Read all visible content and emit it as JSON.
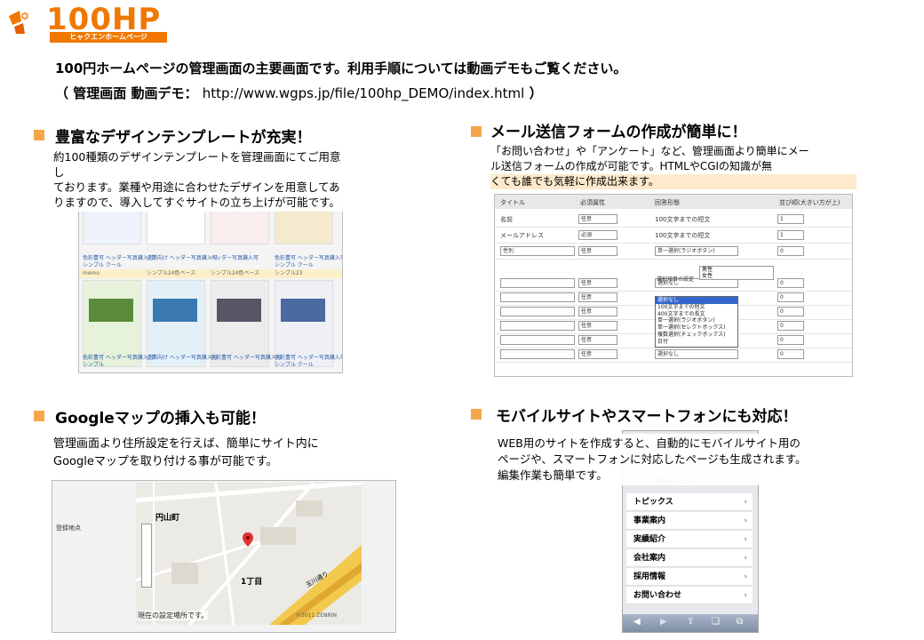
{
  "logo": {
    "text": "100HP",
    "sub": "ヒャクエンホームページ",
    "brand_color": "#f07800"
  },
  "intro": {
    "line1": "100円ホームページの管理画面の主要画面です。利用手順については動画デモもご覧ください。",
    "line2_label": "（ 管理画面  動画デモ：",
    "line2_url": "http://www.wgps.jp/file/100hp_DEMO/index.html",
    "line2_end": "）"
  },
  "sections": {
    "templates": {
      "title": "豊富なデザインテンプレートが充実！",
      "desc": "約100種類のデザインテンプレートを管理画面にてご用意しておりますす。業種や用途に合わせたデザインを用意してありますので、導入してすぐサイトの立ち上げが可能です。",
      "desc_lines": [
        "約100種類のデザインテンプレートを管理画面にてご用意し",
        "ております。業種や用途に合わせたデザインを用意してあ",
        "りますので、導入してすぐサイトの立ち上げが可能です。"
      ],
      "captions": [
        "色彩豊可 ヘッダー写真鎌入可",
        "企業向け ヘッダー写真鎌入可",
        "ヘッダー写真鎌入可",
        "色彩豊可 ヘッダー写真鎌入可",
        "シンプル24色ベース",
        "シンプル24色ベース",
        "シンプル23"
      ],
      "row_labels": [
        "memo",
        "シンプル クール",
        "シンプル",
        "シンプル クール"
      ]
    },
    "mailform": {
      "title": "メール送信フォームの作成が簡単に！",
      "desc_lines": [
        "「お問い合わせ」や「アンケート」など、管理画面より簡単にメー",
        "ル送信フォームの作成が可能です。HTMLやCGIの知識が無",
        "くても誰でも気軽に作成出来ます。"
      ],
      "table": {
        "headers": [
          "タイトル",
          "必須属性",
          "回答形態",
          "並び順(大きい方が上)"
        ],
        "rows": [
          {
            "title": "名前",
            "req": "任意",
            "type": "100文字までの短文",
            "order": "1"
          },
          {
            "title": "メールアドレス",
            "req": "必須",
            "type": "100文字までの短文",
            "order": "1"
          },
          {
            "title": "性別",
            "req": "任意",
            "type": "単一選択(ラジオボタン)",
            "order": "0"
          },
          {
            "title": "",
            "req": "任意",
            "type": "選択なし",
            "order": "0"
          },
          {
            "title": "",
            "req": "任意",
            "type": "",
            "order": "0"
          },
          {
            "title": "",
            "req": "任意",
            "type": "",
            "order": "0"
          },
          {
            "title": "",
            "req": "任意",
            "type": "",
            "order": "0"
          },
          {
            "title": "",
            "req": "任意",
            "type": "",
            "order": "0"
          },
          {
            "title": "",
            "req": "任意",
            "type": "選択なし",
            "order": "0"
          }
        ],
        "choice_label": "選択項目の設定",
        "choices": [
          "男性",
          "女性"
        ],
        "dropdown": [
          "選択なし",
          "100文字までの短文",
          "400文字までの長文",
          "単一選択(ラジオボタン)",
          "単一選択(セレクトボックス)",
          "複数選択(チェックボックス)",
          "日付"
        ]
      }
    },
    "googlemap": {
      "title": "Googleマップの挿入も可能！",
      "desc_lines": [
        "管理画面より住所設定を行えば、簡単にサイト内に",
        "Googleマップを取り付ける事が可能です。"
      ],
      "side_label": "登録地点",
      "map_labels": [
        "円山町",
        "1丁目",
        "玉川通り",
        "現在の設定場所です。",
        "©2011 ZENRIN"
      ]
    },
    "mobile": {
      "title": "モバイルサイトやスマートフォンにも対応！",
      "desc_lines": [
        "WEB用のサイトを作成すると、自動的にモバイルサイト用の",
        "ページや、スマートフォンに対応したページも生成されます。",
        "編集作業も簡単です。"
      ],
      "company": "株式会社ライトアップ",
      "menu": [
        "トピックス",
        "事業案内",
        "実績紹介",
        "会社案内",
        "採用情報",
        "お問い合わせ"
      ]
    }
  },
  "colors": {
    "bullet": "#f5a64a",
    "link_blue": "#2a5aa8"
  }
}
